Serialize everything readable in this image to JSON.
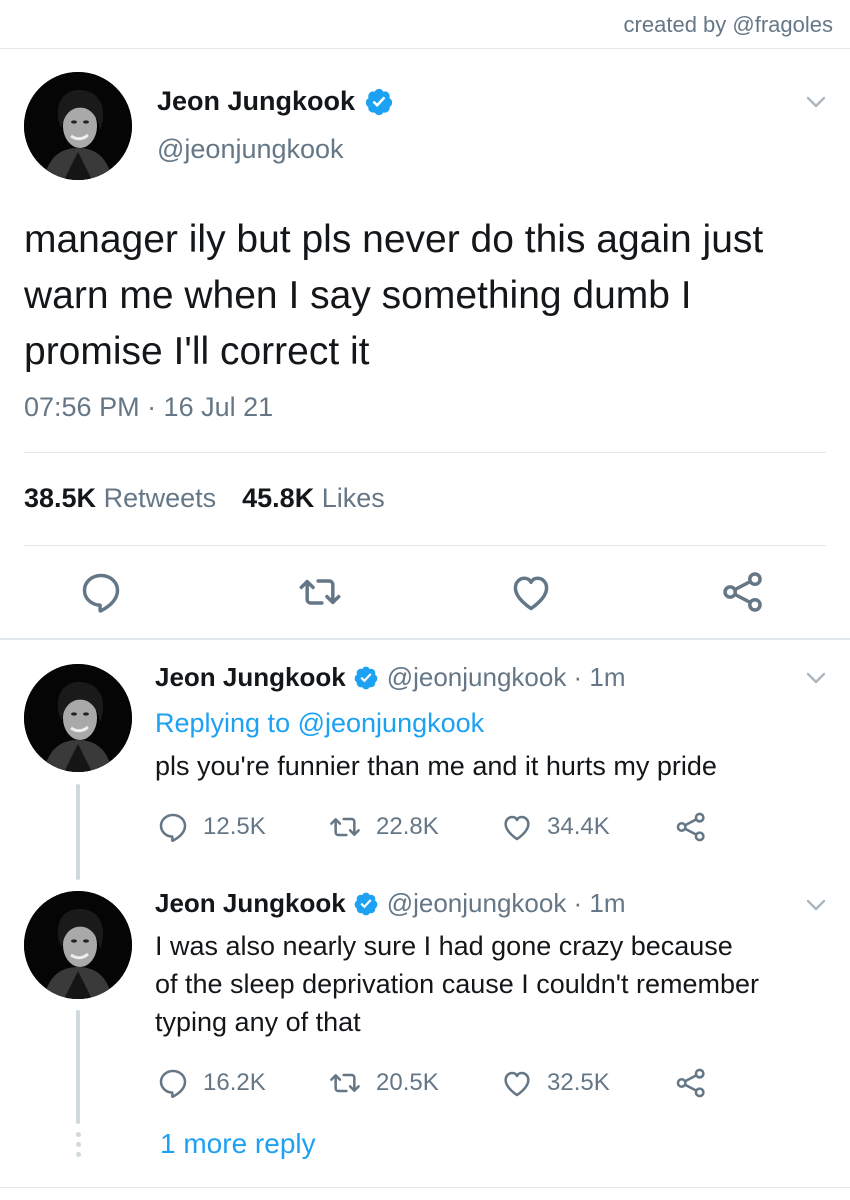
{
  "credit": "created by @fragoles",
  "main": {
    "name": "Jeon Jungkook",
    "handle": "@jeonjungkook",
    "text": "manager ily but pls never do this again just warn me when I say something dumb I promise I'll correct it",
    "time": "07:56 PM · 16 Jul 21",
    "retweets_count": "38.5K",
    "retweets_label": "Retweets",
    "likes_count": "45.8K",
    "likes_label": "Likes"
  },
  "replies": [
    {
      "name": "Jeon Jungkook",
      "meta": "@jeonjungkook · 1m",
      "replying_prefix": "Replying to ",
      "replying_handle": "@jeonjungkook",
      "lines": [
        "pls you're funnier than me and it hurts my pride"
      ],
      "replies": "12.5K",
      "retweets": "22.8K",
      "likes": "34.4K"
    },
    {
      "name": "Jeon Jungkook",
      "meta": "@jeonjungkook · 1m",
      "lines": [
        "I was also nearly sure I had gone crazy because",
        "of the sleep deprivation cause I couldn't remember",
        "typing any of that"
      ],
      "replies": "16.2K",
      "retweets": "20.5K",
      "likes": "32.5K"
    }
  ],
  "more_replies": "1 more reply",
  "colors": {
    "accent": "#1da1f2",
    "muted": "#657786",
    "text": "#14171a",
    "divider": "#e1e8ed"
  }
}
